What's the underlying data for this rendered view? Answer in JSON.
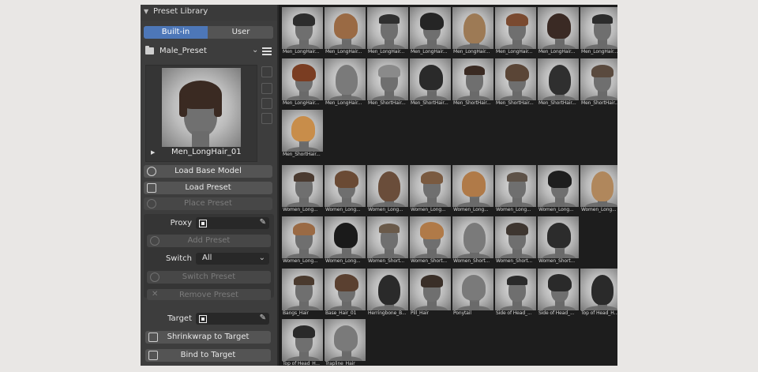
{
  "panel": {
    "title": "Preset Library",
    "tabs": {
      "builtin": "Built-in",
      "user": "User"
    },
    "preset_category": "Male_Preset",
    "preview_name": "Men_LongHair_01",
    "buttons": {
      "load_base_model": "Load Base Model",
      "load_preset": "Load Preset",
      "place_preset": "Place Preset",
      "add_preset": "Add Preset",
      "switch_preset": "Switch Preset",
      "remove_preset": "Remove Preset",
      "shrinkwrap": "Shrinkwrap to Target",
      "bind": "Bind to Target"
    },
    "proxy_label": "Proxy",
    "switch_label": "Switch",
    "switch_value": "All",
    "target_label": "Target"
  },
  "presets": [
    {
      "label": "Men_LongHair...",
      "hair": "#2d2d2d"
    },
    {
      "label": "Men_LongHair...",
      "hair": "#9a6a44"
    },
    {
      "label": "Men_LongHair...",
      "hair": "#2f2f2f"
    },
    {
      "label": "Men_LongHair...",
      "hair": "#252525"
    },
    {
      "label": "Men_LongHair...",
      "hair": "#9d7a55"
    },
    {
      "label": "Men_LongHair...",
      "hair": "#7a4a30"
    },
    {
      "label": "Men_LongHair...",
      "hair": "#3a2a24"
    },
    {
      "label": "Men_LongHair...",
      "hair": "#2c2c2c"
    },
    {
      "label": "Men_LongHair...",
      "hair": "#7a3d22"
    },
    {
      "label": "Men_LongHair...",
      "hair": "#7a7a7a"
    },
    {
      "label": "Men_ShortHair...",
      "hair": "#8a8a8a"
    },
    {
      "label": "Men_ShortHair...",
      "hair": "#2a2a2a"
    },
    {
      "label": "Men_ShortHair...",
      "hair": "#3a2a22"
    },
    {
      "label": "Men_ShortHair...",
      "hair": "#5a4536"
    },
    {
      "label": "Men_ShortHair...",
      "hair": "#2f2f2f"
    },
    {
      "label": "Men_ShortHair...",
      "hair": "#5a4a3e"
    },
    {
      "label": "Men_ShortHair...",
      "hair": "#c88d4a"
    },
    {
      "label": "Women_Long...",
      "hair": "#4a3a30"
    },
    {
      "label": "Women_Long...",
      "hair": "#6a4a34"
    },
    {
      "label": "Women_Long...",
      "hair": "#6a4d3a"
    },
    {
      "label": "Women_Long...",
      "hair": "#7a5a40"
    },
    {
      "label": "Women_Long...",
      "hair": "#b07a48"
    },
    {
      "label": "Women_Long...",
      "hair": "#5e5248"
    },
    {
      "label": "Women_Long...",
      "hair": "#1e1e1e"
    },
    {
      "label": "Women_Long...",
      "hair": "#b0875c"
    },
    {
      "label": "Women_Long...",
      "hair": "#9a6a44"
    },
    {
      "label": "Women_Long...",
      "hair": "#1a1a1a"
    },
    {
      "label": "Women_Short...",
      "hair": "#6a5a4a"
    },
    {
      "label": "Women_Short...",
      "hair": "#b07a48"
    },
    {
      "label": "Women_Short...",
      "hair": "#7a7a7a"
    },
    {
      "label": "Women_Short...",
      "hair": "#3e3630"
    },
    {
      "label": "Women_Short...",
      "hair": "#2c2c2c"
    },
    {
      "label": "Bangs_Hair",
      "hair": "#4a3a2e"
    },
    {
      "label": "Base_Hair_01",
      "hair": "#5a4030"
    },
    {
      "label": "Herringbone_B...",
      "hair": "#2a2a2a"
    },
    {
      "label": "Pill_Hair",
      "hair": "#3a2f28"
    },
    {
      "label": "Ponytail",
      "hair": "#7a7a7a"
    },
    {
      "label": "Side of Head_...",
      "hair": "#2a2a2a"
    },
    {
      "label": "Side of Head_...",
      "hair": "#2a2a2a"
    },
    {
      "label": "Top of Head_H...",
      "hair": "#2a2a2a"
    },
    {
      "label": "Top of Head_H...",
      "hair": "#2a2a2a"
    },
    {
      "label": "Trapline_Hair",
      "hair": "#7a7a7a"
    }
  ]
}
